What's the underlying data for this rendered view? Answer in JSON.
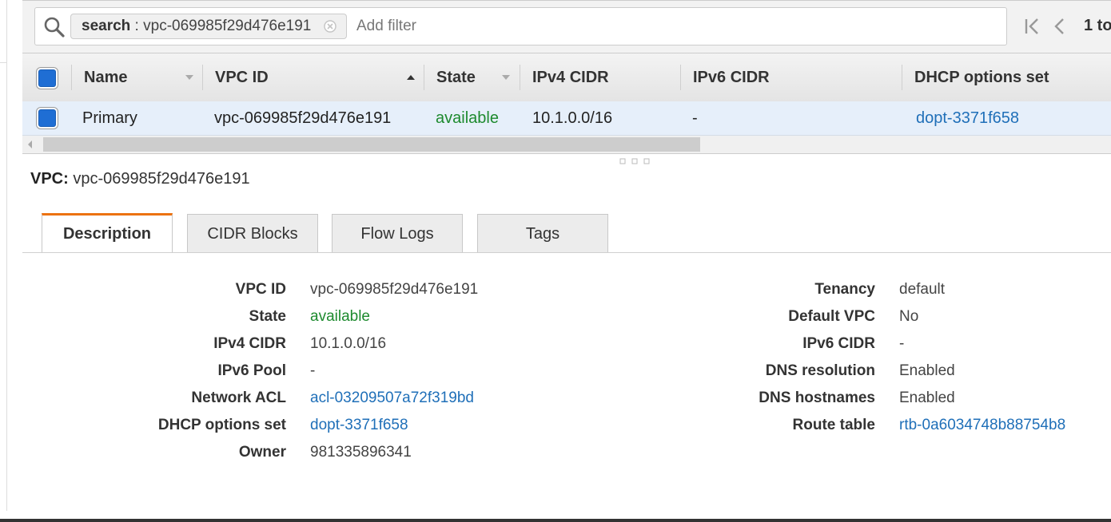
{
  "filter": {
    "token_key": "search",
    "token_sep": " : ",
    "token_value": "vpc-069985f29d476e191",
    "placeholder": "Add filter",
    "pagination_text": "1 to"
  },
  "table": {
    "columns": [
      "Name",
      "VPC ID",
      "State",
      "IPv4 CIDR",
      "IPv6 CIDR",
      "DHCP options set"
    ],
    "rows": [
      {
        "name": "Primary",
        "vpc_id": "vpc-069985f29d476e191",
        "state": "available",
        "ipv4_cidr": "10.1.0.0/16",
        "ipv6_cidr": "-",
        "dhcp_options": "dopt-3371f658"
      }
    ]
  },
  "detail": {
    "title_label": "VPC:",
    "title_value": "vpc-069985f29d476e191",
    "tabs": [
      "Description",
      "CIDR Blocks",
      "Flow Logs",
      "Tags"
    ],
    "active_tab": "Description",
    "left": [
      {
        "label": "VPC ID",
        "value": "vpc-069985f29d476e191"
      },
      {
        "label": "State",
        "value": "available"
      },
      {
        "label": "IPv4 CIDR",
        "value": "10.1.0.0/16"
      },
      {
        "label": "IPv6 Pool",
        "value": "-"
      },
      {
        "label": "Network ACL",
        "value": "acl-03209507a72f319bd"
      },
      {
        "label": "DHCP options set",
        "value": "dopt-3371f658"
      },
      {
        "label": "Owner",
        "value": "981335896341"
      }
    ],
    "right": [
      {
        "label": "Tenancy",
        "value": "default"
      },
      {
        "label": "Default VPC",
        "value": "No"
      },
      {
        "label": "IPv6 CIDR",
        "value": "-"
      },
      {
        "label": "DNS resolution",
        "value": "Enabled"
      },
      {
        "label": "DNS hostnames",
        "value": "Enabled"
      },
      {
        "label": "Route table",
        "value": "rtb-0a6034748b88754b8"
      }
    ]
  },
  "colors": {
    "accent_tab": "#ec7211",
    "link": "#1f6fb8",
    "status_available": "#1d8a2e",
    "checkbox": "#1f6ed4",
    "selected_row": "#e6effa"
  }
}
